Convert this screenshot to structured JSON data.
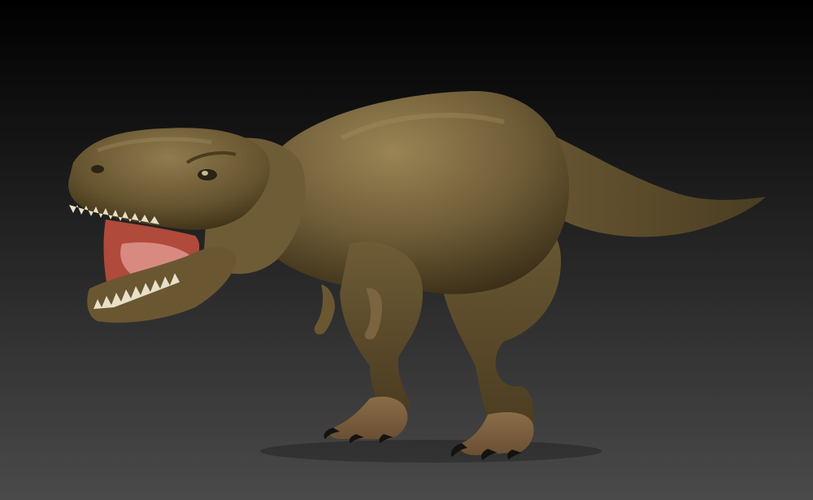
{
  "scene": {
    "subject": "tyrannosaurus-rex-3d-sculpt",
    "background_top": "#000000",
    "background_bottom": "#4a4a4a",
    "skin_light": "#9a8455",
    "skin_mid": "#6e5c36",
    "skin_dark": "#3a2e18",
    "mouth_color": "#b04a3a",
    "tongue_color": "#d98a80",
    "teeth_color": "#e8e0c8",
    "claw_color": "#151210"
  }
}
